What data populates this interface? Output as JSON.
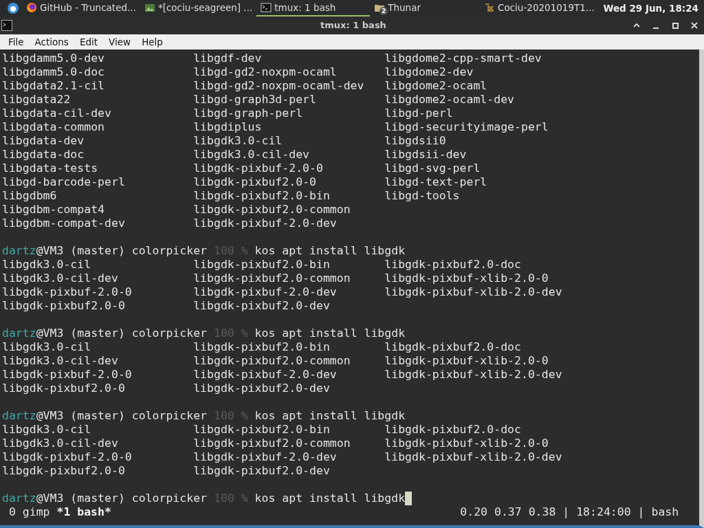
{
  "taskbar": {
    "items": [
      {
        "kind": "browser",
        "label": "GitHub - Truncated...",
        "selected": false
      },
      {
        "kind": "image",
        "label": "*[cociu-seagreen] ...",
        "selected": false
      },
      {
        "kind": "terminal",
        "label": "tmux: 1 bash",
        "selected": true
      },
      {
        "kind": "folder",
        "label": "Thunar",
        "badge": "2",
        "selected": false
      },
      {
        "kind": "office",
        "label": "Cociu-20201019T1...",
        "selected": false
      }
    ],
    "clock": "Wed 29 Jun, 18:24"
  },
  "window": {
    "title": "tmux: 1 bash"
  },
  "menu": [
    "File",
    "Actions",
    "Edit",
    "View",
    "Help"
  ],
  "terminal": {
    "lines": [
      {
        "kind": "columns",
        "cells": [
          "libgdamm5.0-dev",
          "libgdf-dev",
          "libgdome2-cpp-smart-dev"
        ]
      },
      {
        "kind": "columns",
        "cells": [
          "libgdamm5.0-doc",
          "libgd-gd2-noxpm-ocaml",
          "libgdome2-dev"
        ]
      },
      {
        "kind": "columns",
        "cells": [
          "libgdata2.1-cil",
          "libgd-gd2-noxpm-ocaml-dev",
          "libgdome2-ocaml"
        ]
      },
      {
        "kind": "columns",
        "cells": [
          "libgdata22",
          "libgd-graph3d-perl",
          "libgdome2-ocaml-dev"
        ]
      },
      {
        "kind": "columns",
        "cells": [
          "libgdata-cil-dev",
          "libgd-graph-perl",
          "libgd-perl"
        ]
      },
      {
        "kind": "columns",
        "cells": [
          "libgdata-common",
          "libgdiplus",
          "libgd-securityimage-perl"
        ]
      },
      {
        "kind": "columns",
        "cells": [
          "libgdata-dev",
          "libgdk3.0-cil",
          "libgdsii0"
        ]
      },
      {
        "kind": "columns",
        "cells": [
          "libgdata-doc",
          "libgdk3.0-cil-dev",
          "libgdsii-dev"
        ]
      },
      {
        "kind": "columns",
        "cells": [
          "libgdata-tests",
          "libgdk-pixbuf-2.0-0",
          "libgd-svg-perl"
        ]
      },
      {
        "kind": "columns",
        "cells": [
          "libgd-barcode-perl",
          "libgdk-pixbuf2.0-0",
          "libgd-text-perl"
        ]
      },
      {
        "kind": "columns",
        "cells": [
          "libgdbm6",
          "libgdk-pixbuf2.0-bin",
          "libgd-tools"
        ]
      },
      {
        "kind": "columns",
        "cells": [
          "libgdbm-compat4",
          "libgdk-pixbuf2.0-common"
        ]
      },
      {
        "kind": "columns",
        "cells": [
          "libgdbm-compat-dev",
          "libgdk-pixbuf-2.0-dev"
        ]
      },
      {
        "kind": "blank"
      },
      {
        "kind": "prompt",
        "user": "dartz",
        "host": "@VM3 (master) colorpicker",
        "status": "100 %",
        "command": "kos apt install libgdk",
        "cursor": false
      },
      {
        "kind": "columns",
        "cells": [
          "libgdk3.0-cil",
          "libgdk-pixbuf2.0-bin",
          "libgdk-pixbuf2.0-doc"
        ]
      },
      {
        "kind": "columns",
        "cells": [
          "libgdk3.0-cil-dev",
          "libgdk-pixbuf2.0-common",
          "libgdk-pixbuf-xlib-2.0-0"
        ]
      },
      {
        "kind": "columns",
        "cells": [
          "libgdk-pixbuf-2.0-0",
          "libgdk-pixbuf-2.0-dev",
          "libgdk-pixbuf-xlib-2.0-dev"
        ]
      },
      {
        "kind": "columns",
        "cells": [
          "libgdk-pixbuf2.0-0",
          "libgdk-pixbuf2.0-dev"
        ]
      },
      {
        "kind": "blank"
      },
      {
        "kind": "prompt",
        "user": "dartz",
        "host": "@VM3 (master) colorpicker",
        "status": "100 %",
        "command": "kos apt install libgdk",
        "cursor": false
      },
      {
        "kind": "columns",
        "cells": [
          "libgdk3.0-cil",
          "libgdk-pixbuf2.0-bin",
          "libgdk-pixbuf2.0-doc"
        ]
      },
      {
        "kind": "columns",
        "cells": [
          "libgdk3.0-cil-dev",
          "libgdk-pixbuf2.0-common",
          "libgdk-pixbuf-xlib-2.0-0"
        ]
      },
      {
        "kind": "columns",
        "cells": [
          "libgdk-pixbuf-2.0-0",
          "libgdk-pixbuf-2.0-dev",
          "libgdk-pixbuf-xlib-2.0-dev"
        ]
      },
      {
        "kind": "columns",
        "cells": [
          "libgdk-pixbuf2.0-0",
          "libgdk-pixbuf2.0-dev"
        ]
      },
      {
        "kind": "blank"
      },
      {
        "kind": "prompt",
        "user": "dartz",
        "host": "@VM3 (master) colorpicker",
        "status": "100 %",
        "command": "kos apt install libgdk",
        "cursor": false
      },
      {
        "kind": "columns",
        "cells": [
          "libgdk3.0-cil",
          "libgdk-pixbuf2.0-bin",
          "libgdk-pixbuf2.0-doc"
        ]
      },
      {
        "kind": "columns",
        "cells": [
          "libgdk3.0-cil-dev",
          "libgdk-pixbuf2.0-common",
          "libgdk-pixbuf-xlib-2.0-0"
        ]
      },
      {
        "kind": "columns",
        "cells": [
          "libgdk-pixbuf-2.0-0",
          "libgdk-pixbuf-2.0-dev",
          "libgdk-pixbuf-xlib-2.0-dev"
        ]
      },
      {
        "kind": "columns",
        "cells": [
          "libgdk-pixbuf2.0-0",
          "libgdk-pixbuf2.0-dev"
        ]
      },
      {
        "kind": "blank"
      },
      {
        "kind": "prompt",
        "user": "dartz",
        "host": "@VM3 (master) colorpicker",
        "status": "100 %",
        "command": "kos apt install libgdk",
        "cursor": true
      }
    ]
  },
  "tmux_status": {
    "windows": [
      {
        "label": "0 gimp",
        "selected": false
      },
      {
        "label": "*1 bash*",
        "selected": true
      }
    ],
    "right": "0.20 0.37 0.38 | 18:24:00 | bash"
  }
}
